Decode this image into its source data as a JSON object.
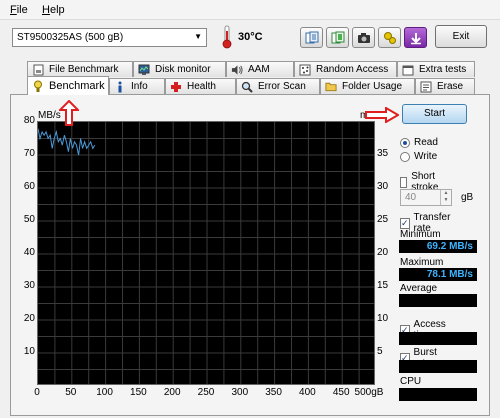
{
  "menu": {
    "file": "File",
    "file_rest": "ile",
    "file_key": "F",
    "help_key": "H",
    "help_rest": "elp"
  },
  "toolbar": {
    "drive": "ST9500325AS (500 gB)",
    "temperature": "30°C",
    "exit_label": "Exit",
    "icons": [
      "copy-text-icon",
      "copy-info-icon",
      "screenshot-icon",
      "options-icon",
      "save-icon"
    ]
  },
  "tabs_top": [
    {
      "label": "File Benchmark",
      "icon": "disk-page-icon"
    },
    {
      "label": "Disk monitor",
      "icon": "monitor-icon"
    },
    {
      "label": "AAM",
      "icon": "speaker-icon"
    },
    {
      "label": "Random Access",
      "icon": "random-access-icon"
    },
    {
      "label": "Extra tests",
      "icon": "extra-tests-icon"
    }
  ],
  "tabs_bottom": [
    {
      "label": "Benchmark",
      "icon": "benchmark-icon",
      "active": true
    },
    {
      "label": "Info",
      "icon": "info-icon"
    },
    {
      "label": "Health",
      "icon": "health-icon"
    },
    {
      "label": "Error Scan",
      "icon": "magnifier-icon"
    },
    {
      "label": "Folder Usage",
      "icon": "folder-icon"
    },
    {
      "label": "Erase",
      "icon": "erase-icon"
    }
  ],
  "chart_data": {
    "type": "line",
    "ylabel_left": "MB/s",
    "ylabel_right": "ms",
    "xlabel_end": "500gB",
    "x_ticks": [
      "0",
      "50",
      "100",
      "150",
      "200",
      "250",
      "300",
      "350",
      "400",
      "450",
      "500gB"
    ],
    "y_ticks_left": [
      "80",
      "70",
      "60",
      "50",
      "40",
      "30",
      "20",
      "10"
    ],
    "y_ticks_right": [
      "35",
      "30",
      "25",
      "20",
      "15",
      "10",
      "5"
    ],
    "xlim": [
      0,
      500
    ],
    "ylim_left": [
      0,
      80
    ],
    "ylim_right": [
      0,
      40
    ],
    "grid": true,
    "series": [
      {
        "color": "#4a9ad6",
        "x": [
          0,
          3,
          6,
          9,
          12,
          15,
          18,
          21,
          24,
          27,
          30,
          33,
          36,
          39,
          42,
          45,
          48,
          51,
          54,
          57,
          60,
          63,
          66,
          69,
          72,
          75,
          78,
          81,
          84
        ],
        "y": [
          78,
          75,
          77,
          76,
          77,
          75,
          76,
          72,
          75,
          77,
          74,
          75,
          73,
          76,
          74,
          71,
          75,
          72,
          74,
          73,
          70,
          75,
          72,
          74,
          72,
          73,
          74,
          72,
          73
        ]
      }
    ]
  },
  "side": {
    "start_label": "Start",
    "read_label": "Read",
    "write_label": "Write",
    "short_stroke_label": "Short stroke",
    "stroke_value": "40",
    "stroke_unit": "gB",
    "transfer_rate_label": "Transfer rate",
    "minimum_label": "Minimum",
    "minimum_value": "69.2 MB/s",
    "maximum_label": "Maximum",
    "maximum_value": "78.1 MB/s",
    "average_label": "Average",
    "average_value": "",
    "access_time_label": "Access time",
    "access_time_value": "",
    "burst_rate_label": "Burst rate",
    "burst_rate_value": "",
    "cpu_usage_label": "CPU usage",
    "cpu_usage_value": ""
  },
  "colors": {
    "accent": "#1b4fa0",
    "value_text": "#3fb4ff",
    "annotation": "#e02020",
    "chart_bg": "#000000",
    "series": "#4a9ad6"
  }
}
